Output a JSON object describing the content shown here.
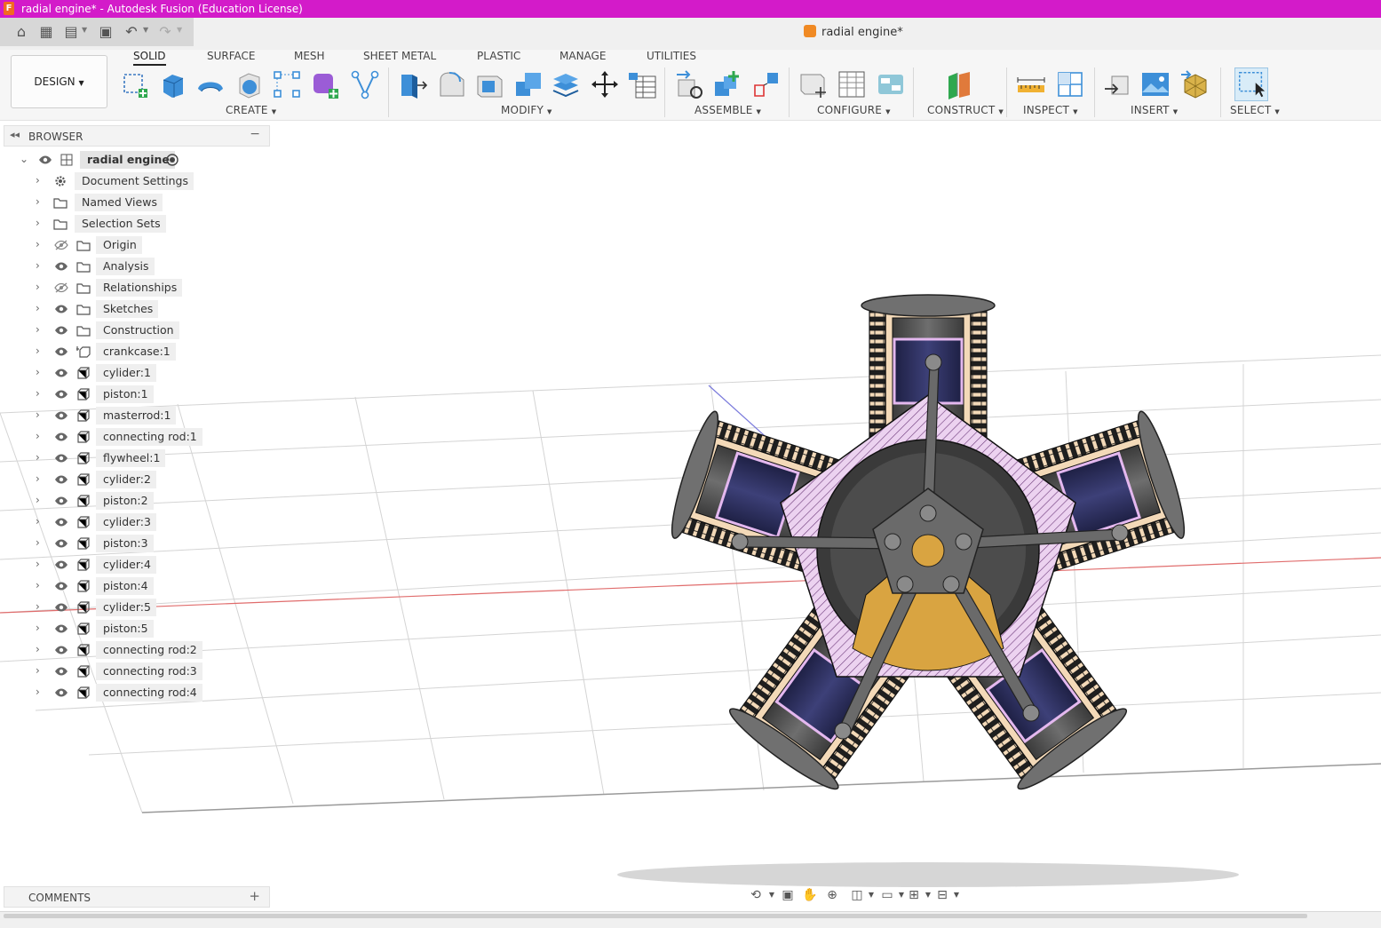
{
  "window": {
    "title": "radial engine* - Autodesk Fusion (Education License)"
  },
  "document_tab": {
    "label": "radial engine*"
  },
  "quick_access": {
    "icons": [
      "home-icon",
      "grid-icon",
      "file-icon",
      "save-icon",
      "undo-icon",
      "redo-icon"
    ]
  },
  "workspace": {
    "label": "DESIGN"
  },
  "ribbon": {
    "tabs": [
      {
        "label": "SOLID",
        "active": true
      },
      {
        "label": "SURFACE"
      },
      {
        "label": "MESH"
      },
      {
        "label": "SHEET METAL"
      },
      {
        "label": "PLASTIC"
      },
      {
        "label": "MANAGE"
      },
      {
        "label": "UTILITIES"
      }
    ],
    "groups": {
      "create": "CREATE",
      "modify": "MODIFY",
      "assemble": "ASSEMBLE",
      "configure": "CONFIGURE",
      "construct": "CONSTRUCT",
      "inspect": "INSPECT",
      "insert": "INSERT",
      "select": "SELECT"
    }
  },
  "browser": {
    "title": "BROWSER",
    "root": {
      "label": "radial engine"
    },
    "items": [
      {
        "label": "Document Settings",
        "type": "settings",
        "eye": "none"
      },
      {
        "label": "Named Views",
        "type": "folder",
        "eye": "none"
      },
      {
        "label": "Selection Sets",
        "type": "folder",
        "eye": "none"
      },
      {
        "label": "Origin",
        "type": "folder",
        "eye": "hidden"
      },
      {
        "label": "Analysis",
        "type": "folder",
        "eye": "visible"
      },
      {
        "label": "Relationships",
        "type": "folder",
        "eye": "hidden"
      },
      {
        "label": "Sketches",
        "type": "folder",
        "eye": "visible"
      },
      {
        "label": "Construction",
        "type": "folder",
        "eye": "visible"
      },
      {
        "label": "crankcase:1",
        "type": "component-grounded",
        "eye": "visible"
      },
      {
        "label": "cylider:1",
        "type": "component",
        "eye": "visible"
      },
      {
        "label": "piston:1",
        "type": "component",
        "eye": "visible"
      },
      {
        "label": "masterrod:1",
        "type": "component",
        "eye": "visible"
      },
      {
        "label": "connecting rod:1",
        "type": "component",
        "eye": "visible"
      },
      {
        "label": "flywheel:1",
        "type": "component",
        "eye": "visible"
      },
      {
        "label": "cylider:2",
        "type": "component",
        "eye": "visible"
      },
      {
        "label": "piston:2",
        "type": "component",
        "eye": "visible"
      },
      {
        "label": "cylider:3",
        "type": "component",
        "eye": "visible"
      },
      {
        "label": "piston:3",
        "type": "component",
        "eye": "visible"
      },
      {
        "label": "cylider:4",
        "type": "component",
        "eye": "visible"
      },
      {
        "label": "piston:4",
        "type": "component",
        "eye": "visible"
      },
      {
        "label": "cylider:5",
        "type": "component",
        "eye": "visible"
      },
      {
        "label": "piston:5",
        "type": "component",
        "eye": "visible"
      },
      {
        "label": "connecting rod:2",
        "type": "component",
        "eye": "visible"
      },
      {
        "label": "connecting rod:3",
        "type": "component",
        "eye": "visible"
      },
      {
        "label": "connecting rod:4",
        "type": "component",
        "eye": "visible"
      }
    ]
  },
  "comments": {
    "title": "COMMENTS"
  },
  "colors": {
    "title_bar": "#d31bc9",
    "section_hatch": "#e9c9ee",
    "fins": "#f3d9b8",
    "piston_blue": "#2d2f5a",
    "metal": "#555555",
    "flywheel": "#d9a441",
    "grid_x_axis": "#e06c6c",
    "grid_z_axis": "#7b7bdc"
  }
}
